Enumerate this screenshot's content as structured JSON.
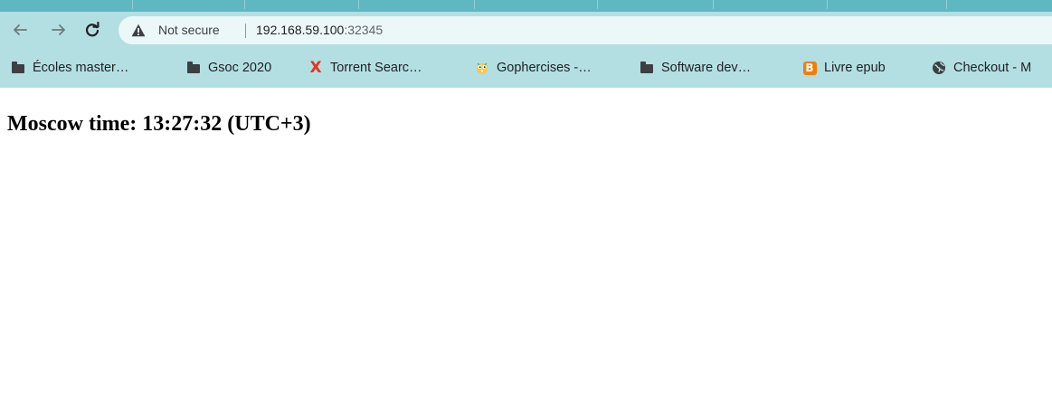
{
  "toolbar": {
    "back_icon": "arrow-left-icon",
    "forward_icon": "arrow-right-icon",
    "reload_icon": "reload-icon"
  },
  "omnibox": {
    "security_icon": "warning-triangle-icon",
    "security_label": "Not secure",
    "url_host": "192.168.59.100",
    "url_port": ":32345"
  },
  "bookmarks": [
    {
      "label": "Écoles master…",
      "icon": "folder-icon"
    },
    {
      "label": "Gsoc 2020",
      "icon": "folder-icon"
    },
    {
      "label": "Torrent Searc…",
      "icon": "x-logo-icon"
    },
    {
      "label": "Gophercises -…",
      "icon": "gopher-icon"
    },
    {
      "label": "Software dev…",
      "icon": "folder-icon"
    },
    {
      "label": "Livre epub",
      "icon": "blogger-icon"
    },
    {
      "label": "Checkout - M",
      "icon": "globe-icon"
    }
  ],
  "page": {
    "heading": "Moscow time: 13:27:32 (UTC+3)"
  },
  "colors": {
    "frame": "#b3dfe3",
    "tabstrip": "#5fb8c1",
    "omnibox_bg": "#ecf7f8",
    "torrent_icon": "#e8321b",
    "blogger_icon": "#f57d00"
  }
}
